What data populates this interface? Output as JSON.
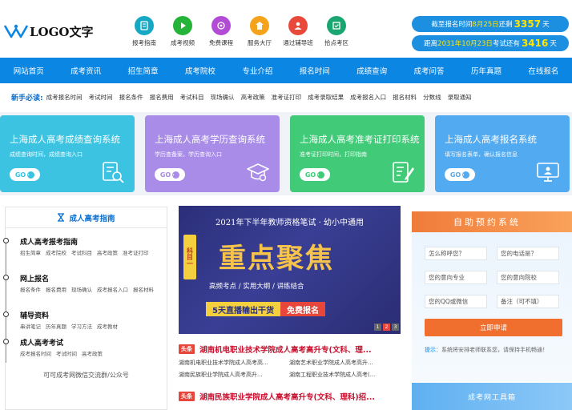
{
  "header": {
    "logo_text": "LOGO文字",
    "quick_links": [
      {
        "label": "报考指南",
        "icon": "guide-icon",
        "color": "#17a9c4"
      },
      {
        "label": "成考视频",
        "icon": "video-icon",
        "color": "#25b33a"
      },
      {
        "label": "免费课程",
        "icon": "course-icon",
        "color": "#b34cd4"
      },
      {
        "label": "服务大厅",
        "icon": "service-icon",
        "color": "#f5a31a"
      },
      {
        "label": "通过辅导班",
        "icon": "tutor-icon",
        "color": "#e8493a"
      },
      {
        "label": "拾点考区",
        "icon": "exam-area-icon",
        "color": "#1aa671"
      }
    ],
    "countdown_1": {
      "prefix": "截至报名时间",
      "date": "8月25日",
      "mid": "还剩",
      "days": "3357",
      "unit": "天"
    },
    "countdown_2": {
      "prefix": "距离",
      "date": "2031年10月23日",
      "mid": "考试还有",
      "days": "3416",
      "unit": "天"
    }
  },
  "nav": [
    "网站首页",
    "成考资讯",
    "招生简章",
    "成考院校",
    "专业介绍",
    "报名时间",
    "成绩查询",
    "成考问答",
    "历年真题",
    "在线报名"
  ],
  "must_read": {
    "title": "新手必读:",
    "links": [
      "成考报名时间",
      "考试时间",
      "报名条件",
      "报名费用",
      "考试科目",
      "现场确认",
      "高考政策",
      "准考证打印",
      "成考录取结果",
      "成考报名入口",
      "报名材料",
      "分数线",
      "录取通知"
    ]
  },
  "banners": [
    {
      "title": "上海成人高考成绩查询系统",
      "sub": "成绩查询时间，成绩查询入口",
      "color": "#3cc3e2",
      "icon": "search-doc-icon"
    },
    {
      "title": "上海成人高考学历查询系统",
      "sub": "学历查备案，学历查询入口",
      "color": "#a98be8",
      "icon": "graduation-cap-icon"
    },
    {
      "title": "上海成人高考准考证打印系统",
      "sub": "准考证打印时间，打印指南",
      "color": "#41cb78",
      "icon": "edit-doc-icon"
    },
    {
      "title": "上海成人高考报名系统",
      "sub": "填写报名表单，确认报名信息",
      "color": "#52aaf0",
      "icon": "computer-icon"
    }
  ],
  "go_label": "GO",
  "guide": {
    "title": "成人高考指南",
    "sections": [
      {
        "title": "成人高考报考指南",
        "links": [
          "招生简章",
          "成考院校",
          "考试科目",
          "高考政策",
          "准考证打印"
        ]
      },
      {
        "title": "网上报名",
        "links": [
          "报名条件",
          "报名费用",
          "现场确认",
          "成考报名入口",
          "报名材料"
        ]
      },
      {
        "title": "辅导资料",
        "links": [
          "串讲笔记",
          "历年真题",
          "学习方法",
          "成考教材"
        ]
      },
      {
        "title": "成人高考考试",
        "links": [
          "成考报名时间",
          "考试时间",
          "高考政策"
        ]
      }
    ],
    "footer": "可可成考网微信交流群/公众号"
  },
  "poster": {
    "top": "2021年下半年教师资格笔试 · 幼小中通用",
    "tag": "科目一",
    "big": "重点聚焦",
    "mid": "高频考点 / 实用大纲 / 讲练结合",
    "bar1": "5天直播输出干货",
    "bar2": "免费报名",
    "pages": [
      "1",
      "2",
      "3"
    ]
  },
  "news": {
    "badge": "头条",
    "headline_1": "湖南机电职业技术学院成人高考高升专(文科、理...",
    "row_1": [
      "湖南机电职业技术学院成人高考高...",
      "湖南艺术职业学院成人高考高升..."
    ],
    "row_2": [
      "湖南民族职业学院成人高考高升...",
      "湖南工程职业技术学院成人高考(..."
    ],
    "headline_2": "湖南民族职业学院成人高考高升专(文科、理科)招..."
  },
  "form": {
    "title": "自助预约系统",
    "fields": [
      "怎么称呼您？",
      "您的电话是？",
      "您的意向专业",
      "您的意向院校",
      "您的QQ或微信",
      "备注（可不填）"
    ],
    "submit": "立即申请",
    "tip_label": "提示：",
    "tip": "系统将安排老师联系您，请保持手机畅通！"
  },
  "tools_title": "成考网工具箱"
}
